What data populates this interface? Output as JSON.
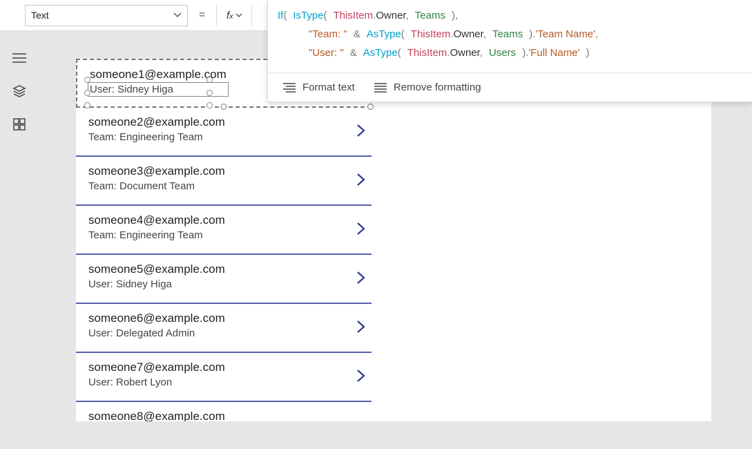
{
  "property": {
    "selected": "Text"
  },
  "formula": {
    "tokens": [
      [
        "fn",
        "If"
      ],
      [
        "op",
        "("
      ],
      [
        "sp",
        " "
      ],
      [
        "fn",
        "IsType"
      ],
      [
        "op",
        "("
      ],
      [
        "sp",
        " "
      ],
      [
        "kw",
        "ThisItem"
      ],
      [
        "op",
        "."
      ],
      [
        "txt",
        "Owner"
      ],
      [
        "op",
        ","
      ],
      [
        "sp",
        " "
      ],
      [
        "prop",
        "Teams"
      ],
      [
        "sp",
        " "
      ],
      [
        "op",
        ")"
      ],
      [
        "op",
        ","
      ],
      [
        "nl"
      ],
      [
        "pad",
        "     "
      ],
      [
        "str",
        "\"Team: \""
      ],
      [
        "sp",
        " "
      ],
      [
        "op",
        "&"
      ],
      [
        "sp",
        " "
      ],
      [
        "fn",
        "AsType"
      ],
      [
        "op",
        "("
      ],
      [
        "sp",
        " "
      ],
      [
        "kw",
        "ThisItem"
      ],
      [
        "op",
        "."
      ],
      [
        "txt",
        "Owner"
      ],
      [
        "op",
        ","
      ],
      [
        "sp",
        " "
      ],
      [
        "prop",
        "Teams"
      ],
      [
        "sp",
        " "
      ],
      [
        "op",
        ")"
      ],
      [
        "op",
        "."
      ],
      [
        "str",
        "'Team Name'"
      ],
      [
        "op",
        ","
      ],
      [
        "nl"
      ],
      [
        "pad",
        "     "
      ],
      [
        "str",
        "\"User: \""
      ],
      [
        "sp",
        " "
      ],
      [
        "op",
        "&"
      ],
      [
        "sp",
        " "
      ],
      [
        "fn",
        "AsType"
      ],
      [
        "op",
        "("
      ],
      [
        "sp",
        " "
      ],
      [
        "kw",
        "ThisItem"
      ],
      [
        "op",
        "."
      ],
      [
        "txt",
        "Owner"
      ],
      [
        "op",
        ","
      ],
      [
        "sp",
        " "
      ],
      [
        "prop",
        "Users"
      ],
      [
        "sp",
        " "
      ],
      [
        "op",
        ")"
      ],
      [
        "op",
        "."
      ],
      [
        "str",
        "'Full Name'"
      ],
      [
        "sp",
        " "
      ],
      [
        "op",
        ")"
      ]
    ]
  },
  "toolbar": {
    "format": "Format text",
    "remove": "Remove formatting"
  },
  "gallery": {
    "items": [
      {
        "title": "someone1@example.com",
        "sub": "User: Sidney Higa",
        "selected": true
      },
      {
        "title": "someone2@example.com",
        "sub": "Team: Engineering Team"
      },
      {
        "title": "someone3@example.com",
        "sub": "Team: Document Team"
      },
      {
        "title": "someone4@example.com",
        "sub": "Team: Engineering Team"
      },
      {
        "title": "someone5@example.com",
        "sub": "User: Sidney Higa"
      },
      {
        "title": "someone6@example.com",
        "sub": "User: Delegated Admin"
      },
      {
        "title": "someone7@example.com",
        "sub": "User: Robert Lyon"
      },
      {
        "title": "someone8@example.com",
        "sub": ""
      }
    ]
  }
}
